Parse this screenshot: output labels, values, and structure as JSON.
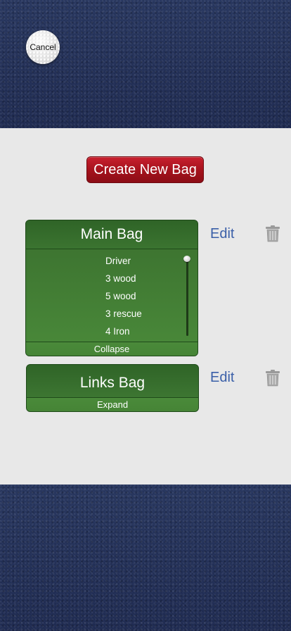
{
  "header": {
    "cancel_label": "Cancel"
  },
  "panel": {
    "create_label": "Create New Bag"
  },
  "bags": [
    {
      "name": "Main Bag",
      "edit_label": "Edit",
      "toggle_label": "Collapse",
      "clubs": [
        "Driver",
        "3 wood",
        "5 wood",
        "3 rescue",
        "4 Iron"
      ]
    },
    {
      "name": "Links Bag",
      "edit_label": "Edit",
      "toggle_label": "Expand"
    }
  ],
  "icons": {
    "cancel": "golf-ball-icon",
    "delete": "trash-icon"
  },
  "colors": {
    "create_button": "#a3121c",
    "bag_green": "#3b7430",
    "edit_link": "#3a5fa8",
    "panel": "#e8e8e8"
  }
}
